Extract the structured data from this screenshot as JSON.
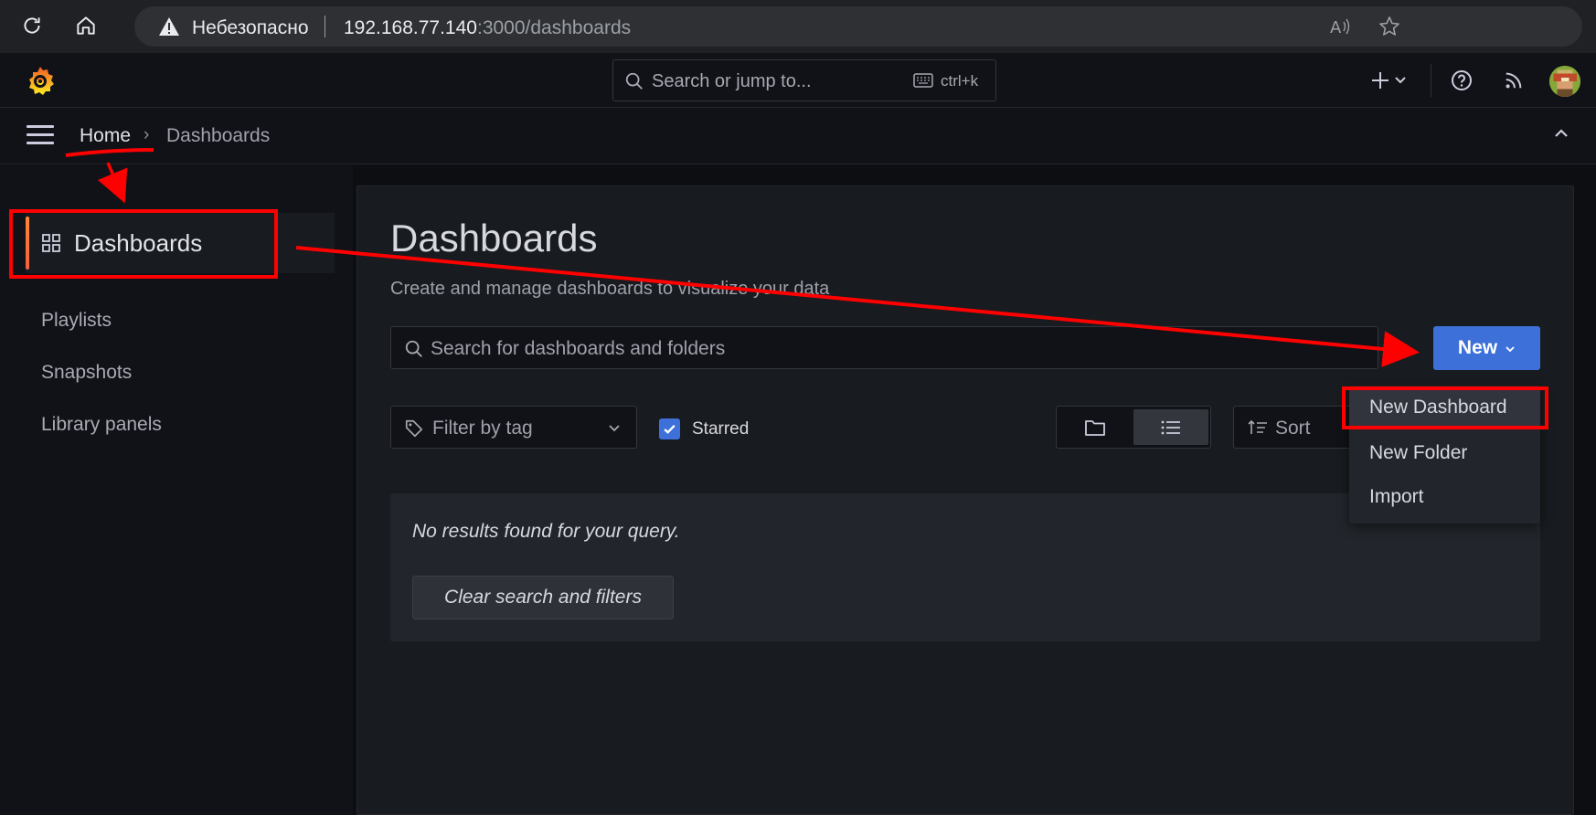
{
  "browser": {
    "insecure_label": "Небезопасно",
    "url_host": "192.168.77.140",
    "url_rest": ":3000/dashboards",
    "icons": [
      "reload-icon",
      "home-icon",
      "warning-icon",
      "read-aloud-icon",
      "favorite-star-icon"
    ]
  },
  "topbar": {
    "search_placeholder": "Search or jump to...",
    "search_shortcut": "ctrl+k",
    "icons": [
      "grafana-logo",
      "search-icon",
      "keyboard-icon",
      "plus-icon",
      "help-icon",
      "news-rss-icon",
      "user-avatar"
    ]
  },
  "breadcrumb": {
    "home": "Home",
    "separator": "›",
    "current": "Dashboards"
  },
  "sidebar": {
    "active_label": "Dashboards",
    "items": [
      {
        "label": "Playlists"
      },
      {
        "label": "Snapshots"
      },
      {
        "label": "Library panels"
      }
    ]
  },
  "main": {
    "title": "Dashboards",
    "subtitle": "Create and manage dashboards to visualize your data",
    "search_placeholder": "Search for dashboards and folders",
    "new_button": "New",
    "tag_filter_placeholder": "Filter by tag",
    "starred_label": "Starred",
    "starred_checked": true,
    "sort_label": "Sort",
    "empty_message": "No results found for your query.",
    "clear_button": "Clear search and filters"
  },
  "new_menu": {
    "items": [
      {
        "label": "New Dashboard"
      },
      {
        "label": "New Folder"
      },
      {
        "label": "Import"
      }
    ]
  },
  "colors": {
    "accent_blue": "#3d71d9",
    "active_bar": "#ff8833",
    "annotation_red": "#ff0000"
  }
}
